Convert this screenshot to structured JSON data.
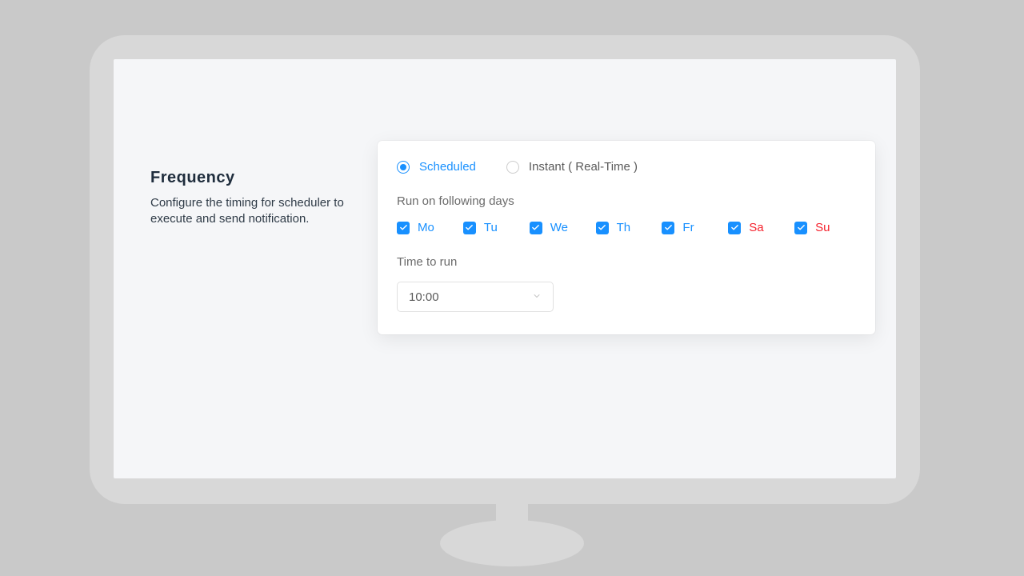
{
  "left": {
    "title": "Frequency",
    "description": "Configure the timing for scheduler to execute and send notification."
  },
  "mode": {
    "scheduled": {
      "label": "Scheduled",
      "selected": true
    },
    "instant": {
      "label": "Instant ( Real-Time )",
      "selected": false
    }
  },
  "days": {
    "section_label": "Run on following days",
    "items": [
      {
        "label": "Mo",
        "checked": true,
        "weekend": false
      },
      {
        "label": "Tu",
        "checked": true,
        "weekend": false
      },
      {
        "label": "We",
        "checked": true,
        "weekend": false
      },
      {
        "label": "Th",
        "checked": true,
        "weekend": false
      },
      {
        "label": "Fr",
        "checked": true,
        "weekend": false
      },
      {
        "label": "Sa",
        "checked": true,
        "weekend": true
      },
      {
        "label": "Su",
        "checked": true,
        "weekend": true
      }
    ]
  },
  "time": {
    "section_label": "Time to run",
    "selected": "10:00"
  }
}
